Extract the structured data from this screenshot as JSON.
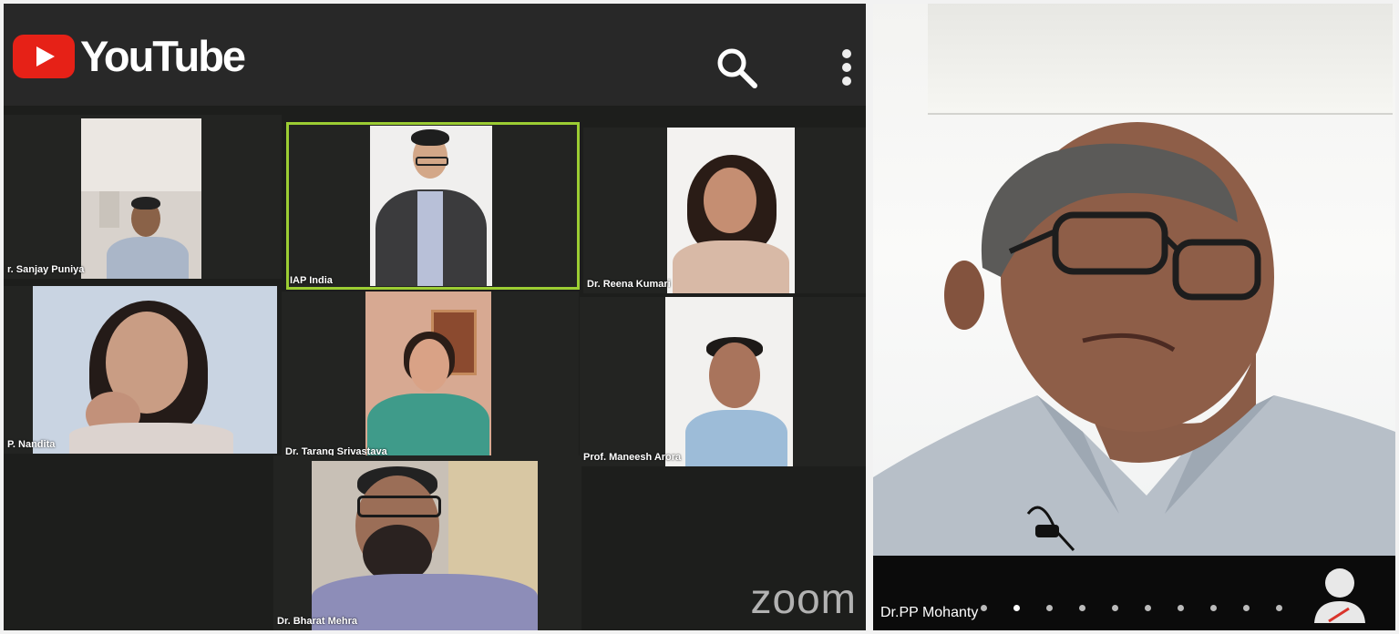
{
  "youtube": {
    "brand": "YouTube",
    "icons": [
      "youtube-logo-icon",
      "search-icon",
      "more-vert-icon"
    ]
  },
  "zoom_grid": {
    "participants": [
      {
        "name": "r. Sanjay Puniya"
      },
      {
        "name": "IAP India",
        "active": true
      },
      {
        "name": "Dr. Reena Kumari"
      },
      {
        "name": "P. Nandita"
      },
      {
        "name": "Dr. Tarang Srivastava"
      },
      {
        "name": "Prof. Maneesh Arora"
      },
      {
        "name": "Dr. Bharat Mehra"
      }
    ],
    "watermark": "zoom",
    "active_border_color": "#9ccd33"
  },
  "speaker_view": {
    "name": "Dr.PP Mohanty",
    "page_dots": 10,
    "current_dot": 1
  }
}
